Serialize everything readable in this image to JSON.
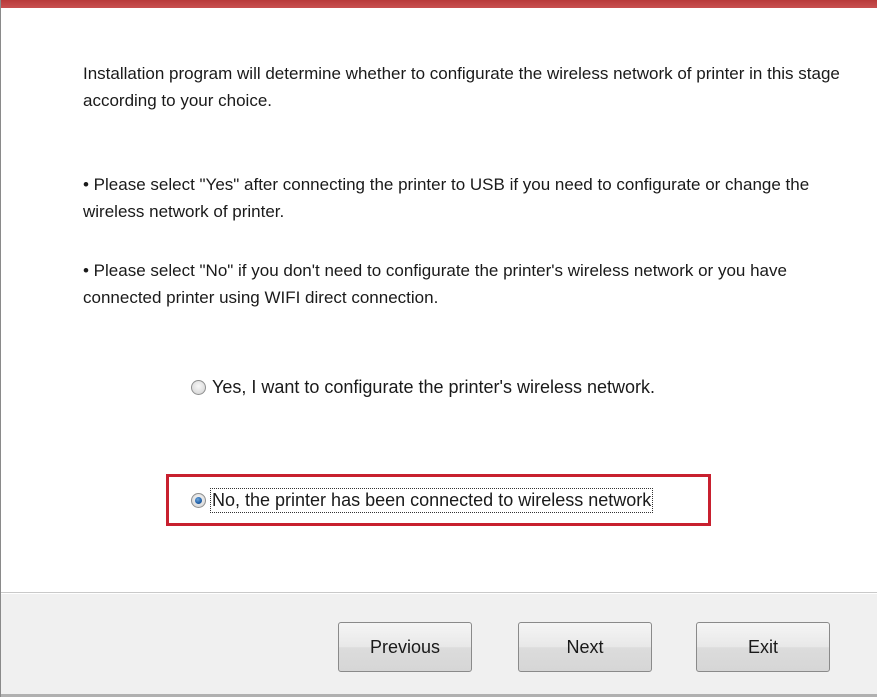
{
  "window": {
    "accent_color": "#c0392b"
  },
  "content": {
    "intro_text": "Installation program will determine whether to configurate the wireless network of printer in this stage according to your choice.",
    "bullet_yes_text": "• Please select \"Yes\" after connecting the printer to USB if you need to configurate or change the wireless network of printer.",
    "bullet_no_text": "• Please select \"No\" if you don't need to configurate the printer's wireless network or you have connected printer using WIFI direct connection."
  },
  "options": {
    "yes_label": "Yes, I want to configurate the printer's wireless network.",
    "no_label": "No, the printer has been connected to wireless network",
    "selected": "no"
  },
  "highlight": {
    "color": "#c8202f"
  },
  "buttons": {
    "previous_label": "Previous",
    "next_label": "Next",
    "exit_label": "Exit"
  }
}
